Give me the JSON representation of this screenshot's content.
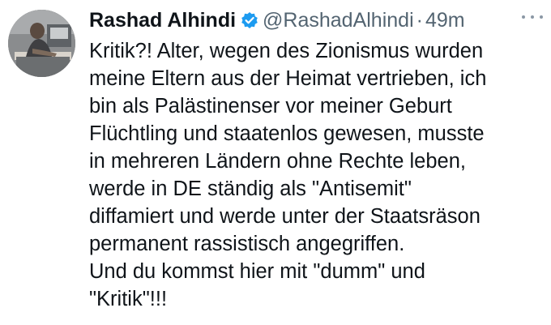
{
  "tweet": {
    "author_name": "Rashad Alhindi",
    "handle": "@RashadAlhindi",
    "separator": "·",
    "time": "49m",
    "verified_icon": "verified-badge-icon",
    "more_icon": "more-options-icon",
    "accent_color": "#1d9bf0",
    "text_lines": [
      "Kritik?! Alter, wegen des Zionismus wurden",
      "meine Eltern aus der Heimat vertrieben, ich",
      "bin als Palästinenser vor meiner Geburt",
      "Flüchtling und staatenlos gewesen, musste",
      "in mehreren Ländern ohne Rechte leben,",
      "werde in DE ständig als \"Antisemit\"",
      "diffamiert und werde unter der Staatsräson",
      "permanent rassistisch angegriffen.",
      "Und du kommst hier mit \"dumm\" und",
      "\"Kritik\"!!!"
    ]
  }
}
